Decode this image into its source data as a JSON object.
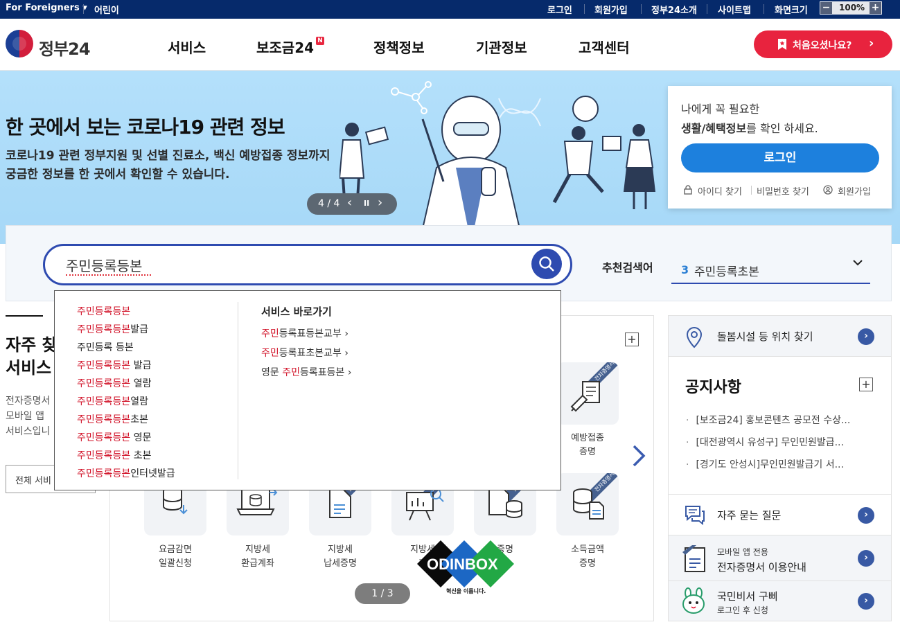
{
  "topbar": {
    "foreigners": "For Foreigners ▾",
    "kids": "어린이",
    "login": "로그인",
    "signup": "회원가입",
    "about": "정부24소개",
    "sitemap": "사이트맵",
    "screen_size": "화면크기",
    "zoom_minus": "−",
    "zoom_level": "100%",
    "zoom_plus": "+"
  },
  "header": {
    "logo_text": "정부24",
    "nav": [
      "서비스",
      "보조금24",
      "정책정보",
      "기관정보",
      "고객센터"
    ],
    "new_badge": "N",
    "first_visit_button": "처음오셨나요?",
    "first_visit_arrow": "›"
  },
  "banner": {
    "title": "한 곳에서 보는 코로나19 관련 정보",
    "desc_line1": "코로나19 관련 정부지원 및 선별 진료소, 백신 예방접종 정보까지",
    "desc_line2": "궁금한 정보를 한 곳에서 확인할 수 있습니다.",
    "pager": "4 / 4",
    "prev": "‹",
    "pause": "II",
    "next": "›"
  },
  "login_box": {
    "line1": "나에게 꼭 필요한",
    "line2_bold": "생활/혜택정보",
    "line2_rest": "를 확인 하세요.",
    "login_button": "로그인",
    "find_id": "아이디 찾기",
    "find_pw": "비밀번호 찾기",
    "join": "회원가입"
  },
  "search": {
    "value": "주민등록등본",
    "rec_label": "추천검색어",
    "rec_rank": "3",
    "rec_term": "주민등록초본"
  },
  "autocomplete": {
    "items": [
      {
        "hl": "주민등록등본",
        "rest": ""
      },
      {
        "hl": "주민등록등본",
        "rest": "발급"
      },
      {
        "hl": "",
        "rest": "주민등록 등본"
      },
      {
        "hl": "주민등록등본",
        "rest": " 발급"
      },
      {
        "hl": "주민등록등본",
        "rest": " 열람"
      },
      {
        "hl": "주민등록등본",
        "rest": "열람"
      },
      {
        "hl": "주민등록등본",
        "rest": "초본"
      },
      {
        "hl": "주민등록등본",
        "rest": " 영문"
      },
      {
        "hl": "주민등록등본",
        "rest": " 초본"
      },
      {
        "hl": "주민등록등본",
        "rest": "인터넷발급"
      }
    ],
    "shortcut_title": "서비스 바로가기",
    "shortcuts": [
      {
        "pre": "",
        "hl": "주민",
        "rest": "등록표등본교부  ›"
      },
      {
        "pre": "",
        "hl": "주민",
        "rest": "등록표초본교부  ›"
      },
      {
        "pre": "영문 ",
        "hl": "주민",
        "rest": "등록표등본  ›"
      }
    ]
  },
  "left": {
    "title_l1": "자주 찾",
    "title_l2": "서비스",
    "desc_l1": "전자증명서",
    "desc_l2": "모바일 앱",
    "desc_l3": "서비스입니",
    "all_button": "전체 서비"
  },
  "services": {
    "plus": "+",
    "next_arrow": "›",
    "ribbon_text": "전자증명서",
    "top_right": {
      "l1": "예방접종",
      "l2": "증명"
    },
    "row2": [
      {
        "l1": "요금감면",
        "l2": "일괄신청"
      },
      {
        "l1": "지방세",
        "l2": "환급계좌"
      },
      {
        "l1": "지방세",
        "l2": "납세증명"
      },
      {
        "l1": "지방세",
        "l2": "과"
      },
      {
        "l1": "증명",
        "l2": ""
      },
      {
        "l1": "소득금액",
        "l2": "증명"
      }
    ],
    "pager": "1 / 3",
    "watermark": "ODINBOX",
    "watermark_sub": "혁신을 이룹니다."
  },
  "right": {
    "care": "돌봄시설 등 위치 찾기",
    "notice_title": "공지사항",
    "notice_plus": "+",
    "notices": [
      "[보조금24] 홍보콘텐츠 공모전 수상...",
      "[대전광역시 유성구] 무인민원발급...",
      "[경기도 안성시]무인민원발급기 서..."
    ],
    "faq": "자주 묻는 질문",
    "mobile_l1": "모바일 앱 전용",
    "mobile_l2": "전자증명서 이용안내",
    "gubbi_l1": "국민비서 구삐",
    "gubbi_l2": "로그인 후 신청",
    "arrow": "›"
  },
  "colors": {
    "topbar": "#062a6b",
    "accent_red": "#e8233e",
    "accent_blue": "#2e4bb0",
    "login_blue": "#1d80dd",
    "banner": "#b4e0fb"
  }
}
